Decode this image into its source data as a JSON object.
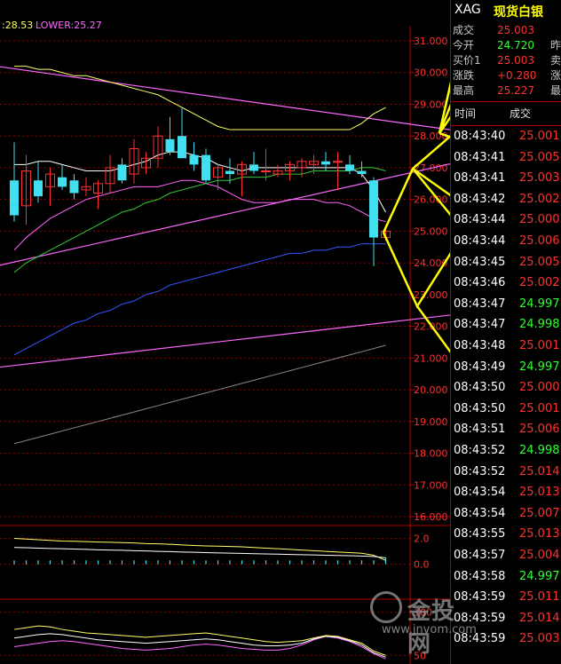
{
  "header": {
    "upper_label": ":28.53",
    "lower_label": "LOWER:25.27",
    "upper_color": "#ffff66",
    "lower_color": "#ff66ff"
  },
  "chart_data": [
    {
      "type": "candlestick",
      "yaxis_ticks": [
        "31.000",
        "30.000",
        "29.000",
        "28.000",
        "27.000",
        "26.000",
        "25.000",
        "24.000",
        "23.000",
        "22.000",
        "21.000",
        "20.000",
        "19.000",
        "18.000",
        "17.000",
        "16.000"
      ],
      "ylim": [
        16.0,
        31.0
      ],
      "candles": [
        {
          "o": 26.6,
          "h": 27.8,
          "l": 25.3,
          "c": 25.5
        },
        {
          "o": 25.8,
          "h": 27.4,
          "l": 25.2,
          "c": 26.9
        },
        {
          "o": 26.6,
          "h": 27.2,
          "l": 25.9,
          "c": 26.1
        },
        {
          "o": 26.4,
          "h": 27.0,
          "l": 25.8,
          "c": 26.8
        },
        {
          "o": 26.7,
          "h": 27.1,
          "l": 26.3,
          "c": 26.4
        },
        {
          "o": 26.6,
          "h": 26.8,
          "l": 26.0,
          "c": 26.2
        },
        {
          "o": 26.3,
          "h": 26.7,
          "l": 26.1,
          "c": 26.4
        },
        {
          "o": 26.2,
          "h": 26.6,
          "l": 25.7,
          "c": 26.5
        },
        {
          "o": 26.5,
          "h": 27.4,
          "l": 26.2,
          "c": 27.0
        },
        {
          "o": 27.1,
          "h": 27.3,
          "l": 26.5,
          "c": 26.6
        },
        {
          "o": 26.8,
          "h": 27.9,
          "l": 26.5,
          "c": 27.6
        },
        {
          "o": 27.0,
          "h": 27.5,
          "l": 26.8,
          "c": 27.3
        },
        {
          "o": 27.3,
          "h": 28.3,
          "l": 27.0,
          "c": 28.0
        },
        {
          "o": 27.9,
          "h": 28.6,
          "l": 27.4,
          "c": 27.5
        },
        {
          "o": 28.0,
          "h": 28.9,
          "l": 27.3,
          "c": 27.3
        },
        {
          "o": 27.4,
          "h": 27.8,
          "l": 26.9,
          "c": 27.1
        },
        {
          "o": 27.4,
          "h": 27.6,
          "l": 26.5,
          "c": 26.6
        },
        {
          "o": 26.7,
          "h": 27.1,
          "l": 26.3,
          "c": 27.0
        },
        {
          "o": 26.9,
          "h": 27.3,
          "l": 26.5,
          "c": 26.8
        },
        {
          "o": 26.8,
          "h": 27.2,
          "l": 26.1,
          "c": 27.1
        },
        {
          "o": 27.1,
          "h": 27.5,
          "l": 26.8,
          "c": 26.9
        },
        {
          "o": 26.9,
          "h": 27.6,
          "l": 26.6,
          "c": 26.9
        },
        {
          "o": 26.8,
          "h": 27.1,
          "l": 26.7,
          "c": 26.9
        },
        {
          "o": 26.9,
          "h": 27.2,
          "l": 26.6,
          "c": 27.1
        },
        {
          "o": 27.0,
          "h": 27.3,
          "l": 26.7,
          "c": 27.2
        },
        {
          "o": 27.1,
          "h": 27.4,
          "l": 26.8,
          "c": 27.2
        },
        {
          "o": 27.2,
          "h": 27.5,
          "l": 26.9,
          "c": 27.1
        },
        {
          "o": 27.2,
          "h": 27.5,
          "l": 26.3,
          "c": 27.2
        },
        {
          "o": 27.1,
          "h": 27.4,
          "l": 26.8,
          "c": 26.9
        },
        {
          "o": 26.9,
          "h": 27.2,
          "l": 26.7,
          "c": 26.8
        },
        {
          "o": 26.6,
          "h": 26.7,
          "l": 23.9,
          "c": 24.8
        },
        {
          "o": 24.8,
          "h": 25.2,
          "l": 24.7,
          "c": 25.0
        }
      ],
      "overlays": [
        {
          "name": "upper",
          "color": "#ffff66",
          "values": [
            30.2,
            30.2,
            30.1,
            30.1,
            30.0,
            29.9,
            29.9,
            29.8,
            29.7,
            29.6,
            29.5,
            29.4,
            29.3,
            29.1,
            28.9,
            28.7,
            28.5,
            28.3,
            28.2,
            28.2,
            28.2,
            28.2,
            28.2,
            28.2,
            28.2,
            28.2,
            28.2,
            28.2,
            28.2,
            28.4,
            28.7,
            28.9
          ]
        },
        {
          "name": "mid",
          "color": "#ffffff",
          "values": [
            27.1,
            27.1,
            27.2,
            27.2,
            27.1,
            27.0,
            26.9,
            26.9,
            26.9,
            27.0,
            27.1,
            27.2,
            27.4,
            27.5,
            27.5,
            27.4,
            27.3,
            27.1,
            27.0,
            26.9,
            27.0,
            27.0,
            27.0,
            27.0,
            27.0,
            27.0,
            27.0,
            27.0,
            27.0,
            26.8,
            26.3,
            25.6
          ]
        },
        {
          "name": "lower",
          "color": "#ff66ff",
          "values": [
            24.4,
            24.8,
            25.1,
            25.4,
            25.6,
            25.8,
            26.0,
            26.1,
            26.2,
            26.3,
            26.4,
            26.4,
            26.4,
            26.5,
            26.6,
            26.6,
            26.5,
            26.4,
            26.2,
            26.0,
            25.9,
            25.9,
            25.9,
            26.0,
            26.0,
            26.0,
            25.9,
            25.9,
            25.8,
            25.6,
            25.4,
            25.3
          ]
        },
        {
          "name": "ma-green",
          "color": "#33cc33",
          "values": [
            23.7,
            24.0,
            24.2,
            24.4,
            24.6,
            24.8,
            25.0,
            25.2,
            25.4,
            25.6,
            25.7,
            25.9,
            26.0,
            26.2,
            26.3,
            26.4,
            26.5,
            26.6,
            26.6,
            26.7,
            26.7,
            26.7,
            26.8,
            26.8,
            26.8,
            26.9,
            26.9,
            26.9,
            26.9,
            27.0,
            27.0,
            26.9
          ]
        },
        {
          "name": "ma-blue",
          "color": "#3355ff",
          "values": [
            21.1,
            21.3,
            21.5,
            21.7,
            21.9,
            22.1,
            22.2,
            22.4,
            22.5,
            22.7,
            22.8,
            23.0,
            23.1,
            23.3,
            23.4,
            23.5,
            23.6,
            23.7,
            23.8,
            23.9,
            24.0,
            24.1,
            24.2,
            24.3,
            24.3,
            24.4,
            24.4,
            24.5,
            24.5,
            24.6,
            24.6,
            24.6
          ]
        },
        {
          "name": "ma-gray",
          "color": "#888888",
          "values": [
            18.3,
            18.4,
            18.5,
            18.6,
            18.7,
            18.8,
            18.9,
            19.0,
            19.1,
            19.2,
            19.3,
            19.4,
            19.5,
            19.6,
            19.7,
            19.8,
            19.9,
            20.0,
            20.1,
            20.2,
            20.3,
            20.4,
            20.5,
            20.6,
            20.7,
            20.8,
            20.9,
            21.0,
            21.1,
            21.2,
            21.3,
            21.4
          ]
        }
      ],
      "trend_lines": [
        {
          "color": "#ff66ff",
          "from": {
            "i": -1.5,
            "v": 30.2
          },
          "to": {
            "i": 42,
            "v": 27.9
          }
        },
        {
          "color": "#ff66ff",
          "from": {
            "i": -1.5,
            "v": 23.9
          },
          "to": {
            "i": 42,
            "v": 27.6
          }
        },
        {
          "color": "#ff66ff",
          "from": {
            "i": -1.5,
            "v": 20.7
          },
          "to": {
            "i": 42,
            "v": 22.6
          }
        }
      ],
      "annotation_arrows": [
        [
          [
            432,
            262
          ],
          [
            470,
            345
          ],
          [
            525,
            258
          ]
        ],
        [
          [
            470,
            345
          ],
          [
            545,
            448
          ]
        ],
        [
          [
            432,
            262
          ],
          [
            465,
            190
          ],
          [
            538,
            127
          ]
        ],
        [
          [
            465,
            190
          ],
          [
            550,
            250
          ]
        ],
        [
          [
            465,
            190
          ],
          [
            555,
            300
          ]
        ],
        [
          [
            495,
            150
          ],
          [
            550,
            170
          ]
        ],
        [
          [
            495,
            150
          ],
          [
            540,
            85
          ]
        ],
        [
          [
            495,
            150
          ],
          [
            515,
            62
          ]
        ],
        [
          [
            495,
            150
          ],
          [
            548,
            18
          ]
        ]
      ]
    },
    {
      "type": "bar",
      "yaxis_ticks": [
        "2.0",
        "0.0"
      ],
      "ylim": [
        -2.5,
        3.0
      ],
      "series": [
        {
          "name": "line-a",
          "color": "#ffff66",
          "values": [
            2.0,
            1.95,
            1.9,
            1.85,
            1.8,
            1.78,
            1.75,
            1.72,
            1.7,
            1.68,
            1.65,
            1.6,
            1.58,
            1.55,
            1.5,
            1.45,
            1.42,
            1.4,
            1.38,
            1.35,
            1.3,
            1.25,
            1.2,
            1.15,
            1.1,
            1.05,
            1.0,
            0.95,
            0.9,
            0.85,
            0.7,
            0.3
          ]
        },
        {
          "name": "line-b",
          "color": "#ffffff",
          "values": [
            1.3,
            1.28,
            1.25,
            1.22,
            1.2,
            1.18,
            1.15,
            1.12,
            1.1,
            1.08,
            1.05,
            1.03,
            1.0,
            0.98,
            0.95,
            0.93,
            0.9,
            0.88,
            0.86,
            0.84,
            0.82,
            0.8,
            0.78,
            0.76,
            0.74,
            0.72,
            0.7,
            0.68,
            0.66,
            0.64,
            0.6,
            0.5
          ]
        }
      ],
      "bars": [
        0.3,
        0.3,
        0.3,
        0.3,
        0.3,
        0.3,
        0.3,
        0.3,
        0.3,
        0.3,
        0.3,
        0.3,
        0.3,
        0.3,
        0.3,
        0.3,
        0.3,
        0.3,
        0.3,
        0.3,
        0.3,
        0.3,
        0.3,
        0.3,
        0.3,
        0.3,
        0.3,
        0.3,
        0.3,
        0.3,
        0.3,
        0.5
      ]
    },
    {
      "type": "line",
      "yaxis_ticks": [
        "100",
        "50"
      ],
      "ylim": [
        40,
        115
      ],
      "series": [
        {
          "name": "k",
          "color": "#ffff66",
          "values": [
            80,
            82,
            84,
            83,
            80,
            78,
            76,
            75,
            74,
            73,
            72,
            71,
            72,
            73,
            74,
            75,
            76,
            74,
            72,
            70,
            68,
            66,
            65,
            66,
            67,
            70,
            73,
            72,
            68,
            64,
            55,
            50
          ]
        },
        {
          "name": "d",
          "color": "#ff66ff",
          "values": [
            60,
            62,
            64,
            66,
            67,
            66,
            64,
            62,
            60,
            58,
            57,
            56,
            57,
            58,
            60,
            62,
            63,
            62,
            60,
            58,
            57,
            56,
            56,
            58,
            62,
            68,
            72,
            70,
            66,
            60,
            52,
            46
          ]
        },
        {
          "name": "j",
          "color": "#ffffff",
          "values": [
            70,
            72,
            74,
            75,
            74,
            72,
            70,
            68,
            67,
            66,
            65,
            64,
            65,
            66,
            67,
            68,
            69,
            68,
            66,
            64,
            62,
            61,
            61,
            62,
            64,
            69,
            72,
            71,
            67,
            62,
            53,
            48
          ]
        }
      ]
    }
  ],
  "quote": {
    "symbol": "XAG",
    "name": "现货白银",
    "rows": [
      {
        "label": "成交",
        "value": "25.003",
        "color": "#ff3030",
        "suffix": ""
      },
      {
        "label": "今开",
        "value": "24.720",
        "color": "#30ff30",
        "suffix": "昨"
      },
      {
        "label": "买价1",
        "value": "25.003",
        "color": "#ff3030",
        "suffix": "卖"
      },
      {
        "label": "涨跌",
        "value": "+0.280",
        "color": "#ff3030",
        "suffix": "涨"
      },
      {
        "label": "最高",
        "value": "25.227",
        "color": "#ff3030",
        "suffix": "最"
      }
    ]
  },
  "ticks_table": {
    "col_time": "时间",
    "col_price": "成交",
    "rows": [
      {
        "time": "08:43:40",
        "price": "25.001",
        "color": "#ff3030"
      },
      {
        "time": "08:43:41",
        "price": "25.005",
        "color": "#ff3030"
      },
      {
        "time": "08:43:41",
        "price": "25.003",
        "color": "#ff3030"
      },
      {
        "time": "08:43:42",
        "price": "25.002",
        "color": "#ff3030"
      },
      {
        "time": "08:43:44",
        "price": "25.000",
        "color": "#ff3030"
      },
      {
        "time": "08:43:44",
        "price": "25.006",
        "color": "#ff3030"
      },
      {
        "time": "08:43:45",
        "price": "25.005",
        "color": "#ff3030"
      },
      {
        "time": "08:43:46",
        "price": "25.002",
        "color": "#ff3030"
      },
      {
        "time": "08:43:47",
        "price": "24.997",
        "color": "#30ff30"
      },
      {
        "time": "08:43:47",
        "price": "24.998",
        "color": "#30ff30"
      },
      {
        "time": "08:43:48",
        "price": "25.001",
        "color": "#ff3030"
      },
      {
        "time": "08:43:49",
        "price": "24.997",
        "color": "#30ff30"
      },
      {
        "time": "08:43:50",
        "price": "25.000",
        "color": "#ff3030"
      },
      {
        "time": "08:43:50",
        "price": "25.001",
        "color": "#ff3030"
      },
      {
        "time": "08:43:51",
        "price": "25.006",
        "color": "#ff3030"
      },
      {
        "time": "08:43:52",
        "price": "24.998",
        "color": "#30ff30"
      },
      {
        "time": "08:43:52",
        "price": "25.014",
        "color": "#ff3030"
      },
      {
        "time": "08:43:54",
        "price": "25.013",
        "color": "#ff3030"
      },
      {
        "time": "08:43:54",
        "price": "25.007",
        "color": "#ff3030"
      },
      {
        "time": "08:43:55",
        "price": "25.013",
        "color": "#ff3030"
      },
      {
        "time": "08:43:57",
        "price": "25.004",
        "color": "#ff3030"
      },
      {
        "time": "08:43:58",
        "price": "24.997",
        "color": "#30ff30"
      },
      {
        "time": "08:43:59",
        "price": "25.011",
        "color": "#ff3030"
      },
      {
        "time": "08:43:59",
        "price": "25.014",
        "color": "#ff3030"
      },
      {
        "time": "08:43:59",
        "price": "25.003",
        "color": "#ff3030"
      }
    ]
  },
  "watermark": {
    "brand": "金投网",
    "url": "www.jnvom.com"
  },
  "colors": {
    "grid_red": "#b40000",
    "up_candle": "#ff3030",
    "down_candle": "#40e0f0",
    "arrow": "#ffff00",
    "axis_text": "#ff3030"
  }
}
